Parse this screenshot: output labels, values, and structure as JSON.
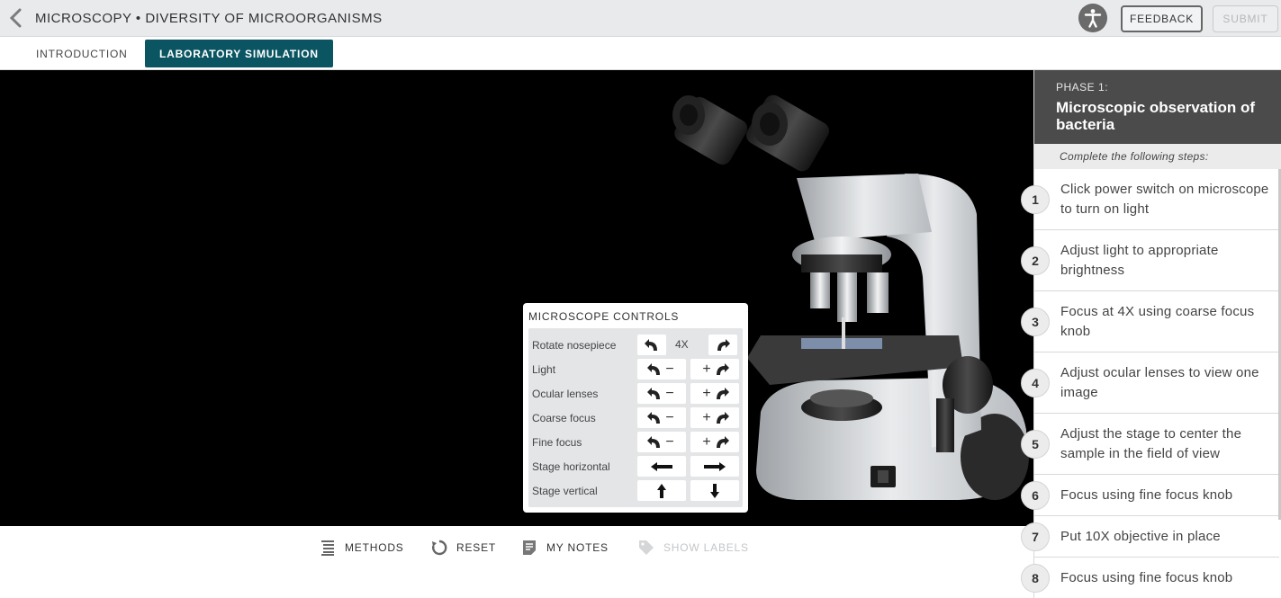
{
  "header": {
    "title": "MICROSCOPY • DIVERSITY OF MICROORGANISMS",
    "feedback_label": "FEEDBACK",
    "submit_label": "SUBMIT"
  },
  "tabs": [
    {
      "label": "INTRODUCTION",
      "active": false
    },
    {
      "label": "LABORATORY SIMULATION",
      "active": true
    }
  ],
  "controls": {
    "title": "MICROSCOPE CONTROLS",
    "rows": [
      {
        "label": "Rotate nosepiece",
        "value": "4X"
      },
      {
        "label": "Light"
      },
      {
        "label": "Ocular lenses"
      },
      {
        "label": "Coarse focus"
      },
      {
        "label": "Fine focus"
      },
      {
        "label": "Stage horizontal"
      },
      {
        "label": "Stage vertical"
      }
    ],
    "minus": "−",
    "plus": "+"
  },
  "toolbar": {
    "methods": "METHODS",
    "reset": "RESET",
    "notes": "MY NOTES",
    "labels": "SHOW LABELS"
  },
  "panel": {
    "phase_label": "PHASE 1:",
    "phase_title": "Microscopic observation of bacteria",
    "intro": "Complete the following steps:",
    "steps": [
      {
        "num": "1",
        "text": "Click power switch on microscope to turn on light"
      },
      {
        "num": "2",
        "text": "Adjust light to appropriate brightness"
      },
      {
        "num": "3",
        "text": "Focus at 4X using coarse focus knob"
      },
      {
        "num": "4",
        "text": "Adjust ocular lenses to view one image"
      },
      {
        "num": "5",
        "text": "Adjust the stage to center the sample in the field of view"
      },
      {
        "num": "6",
        "text": "Focus using fine focus knob"
      },
      {
        "num": "7",
        "text": "Put 10X objective in place"
      },
      {
        "num": "8",
        "text": "Focus using fine focus knob"
      }
    ]
  },
  "colors": {
    "accent": "#0b5563",
    "phase_header": "#4b4b4b"
  }
}
